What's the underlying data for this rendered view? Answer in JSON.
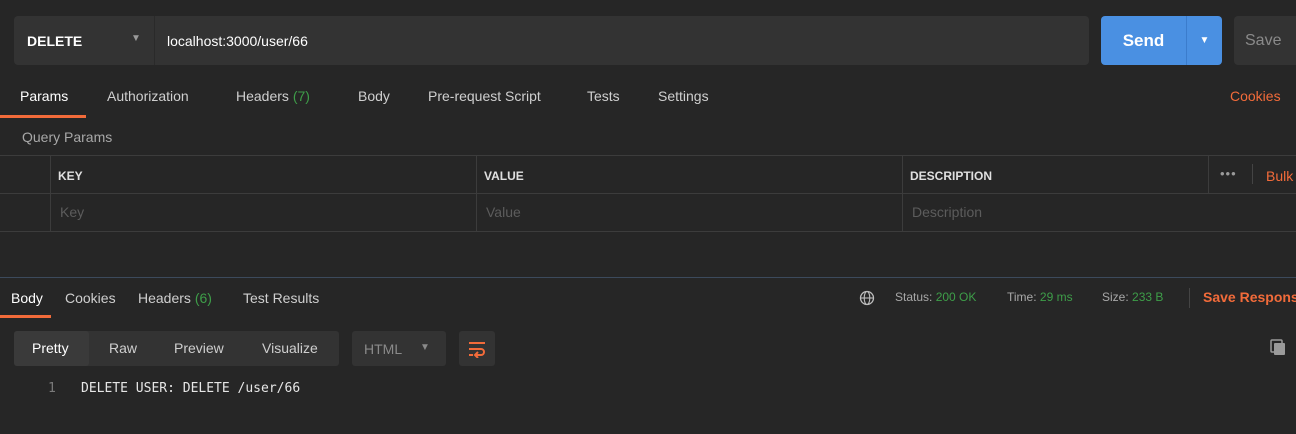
{
  "request": {
    "method": "DELETE",
    "url": "localhost:3000/user/66",
    "send_label": "Send",
    "save_label": "Save"
  },
  "request_tabs": [
    {
      "label": "Params",
      "count": "",
      "active": true
    },
    {
      "label": "Authorization",
      "count": ""
    },
    {
      "label": "Headers",
      "count": "(7)"
    },
    {
      "label": "Body",
      "count": ""
    },
    {
      "label": "Pre-request Script",
      "count": ""
    },
    {
      "label": "Tests",
      "count": ""
    },
    {
      "label": "Settings",
      "count": ""
    }
  ],
  "cookies_label": "Cookies",
  "query_params": {
    "title": "Query Params",
    "columns": [
      "KEY",
      "VALUE",
      "DESCRIPTION"
    ],
    "placeholders": [
      "Key",
      "Value",
      "Description"
    ],
    "more_icon": "more-horizontal-icon",
    "bulk_edit_label": "Bulk"
  },
  "response_tabs": [
    {
      "label": "Body",
      "count": "",
      "active": true
    },
    {
      "label": "Cookies",
      "count": ""
    },
    {
      "label": "Headers",
      "count": "(6)"
    },
    {
      "label": "Test Results",
      "count": ""
    }
  ],
  "response_status": {
    "globe_icon": "globe-icon",
    "status_label": "Status:",
    "status_value": "200 OK",
    "time_label": "Time:",
    "time_value": "29 ms",
    "size_label": "Size:",
    "size_value": "233 B",
    "save_response_label": "Save Respons"
  },
  "view_modes": [
    "Pretty",
    "Raw",
    "Preview",
    "Visualize"
  ],
  "format": "HTML",
  "response_body": [
    {
      "line": "1",
      "text": "DELETE USER: DELETE /user/66"
    }
  ],
  "colors": {
    "accent": "#f26b3a",
    "primary": "#4a90e2",
    "success": "#3e9e49",
    "background": "#262626"
  }
}
